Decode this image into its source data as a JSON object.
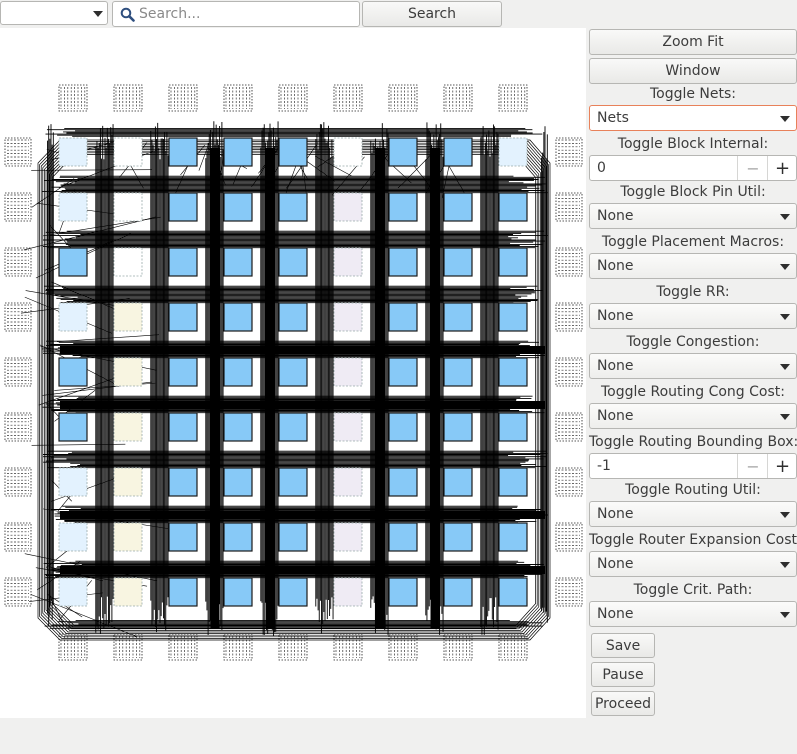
{
  "toolbar": {
    "search_placeholder": "Search...",
    "search_value": "",
    "search_button": "Search"
  },
  "canvas": {
    "description_icon": "fpga-placement-routing-view",
    "colors": {
      "clb": "#87c9f7",
      "io": "#e3f2fe",
      "mem": "#f8f5e1",
      "dsp": "#efebf4",
      "empty": "#ffffff",
      "wire": "#000000"
    },
    "grid_rows": [
      [
        "io",
        "empty",
        "clb",
        "clb",
        "clb",
        "empty",
        "clb",
        "clb",
        "io"
      ],
      [
        "io",
        "empty",
        "clb",
        "clb",
        "clb",
        "dsp",
        "clb",
        "clb",
        "clb"
      ],
      [
        "clb",
        "empty",
        "clb",
        "clb",
        "clb",
        "dsp",
        "clb",
        "clb",
        "clb"
      ],
      [
        "io",
        "mem",
        "clb",
        "clb",
        "clb",
        "dsp",
        "clb",
        "clb",
        "clb"
      ],
      [
        "clb",
        "mem",
        "clb",
        "clb",
        "clb",
        "dsp",
        "clb",
        "clb",
        "clb"
      ],
      [
        "clb",
        "mem",
        "clb",
        "clb",
        "clb",
        "dsp",
        "clb",
        "clb",
        "clb"
      ],
      [
        "io",
        "mem",
        "clb",
        "clb",
        "clb",
        "dsp",
        "clb",
        "clb",
        "clb"
      ],
      [
        "io",
        "mem",
        "clb",
        "clb",
        "clb",
        "dsp",
        "clb",
        "clb",
        "clb"
      ],
      [
        "io",
        "mem",
        "clb",
        "clb",
        "clb",
        "dsp",
        "clb",
        "clb",
        "clb"
      ]
    ]
  },
  "panel": {
    "zoom_fit": "Zoom Fit",
    "window": "Window",
    "nets_label": "Toggle Nets:",
    "nets_value": "Nets",
    "block_internal_label": "Toggle Block Internal:",
    "block_internal_value": "0",
    "block_pin_util_label": "Toggle Block Pin Util:",
    "block_pin_util_value": "None",
    "placement_macros_label": "Toggle Placement Macros:",
    "placement_macros_value": "None",
    "rr_label": "Toggle RR:",
    "rr_value": "None",
    "congestion_label": "Toggle Congestion:",
    "congestion_value": "None",
    "routing_cong_cost_label": "Toggle Routing Cong Cost:",
    "routing_cong_cost_value": "None",
    "routing_bb_label": "Toggle Routing Bounding Box:",
    "routing_bb_value": "-1",
    "routing_util_label": "Toggle Routing Util:",
    "routing_util_value": "None",
    "router_expansion_label": "Toggle Router Expansion Costs:",
    "router_expansion_value": "None",
    "crit_path_label": "Toggle Crit. Path:",
    "crit_path_value": "None",
    "minus_glyph": "−",
    "plus_glyph": "+",
    "save": "Save",
    "pause": "Pause",
    "proceed": "Proceed"
  }
}
